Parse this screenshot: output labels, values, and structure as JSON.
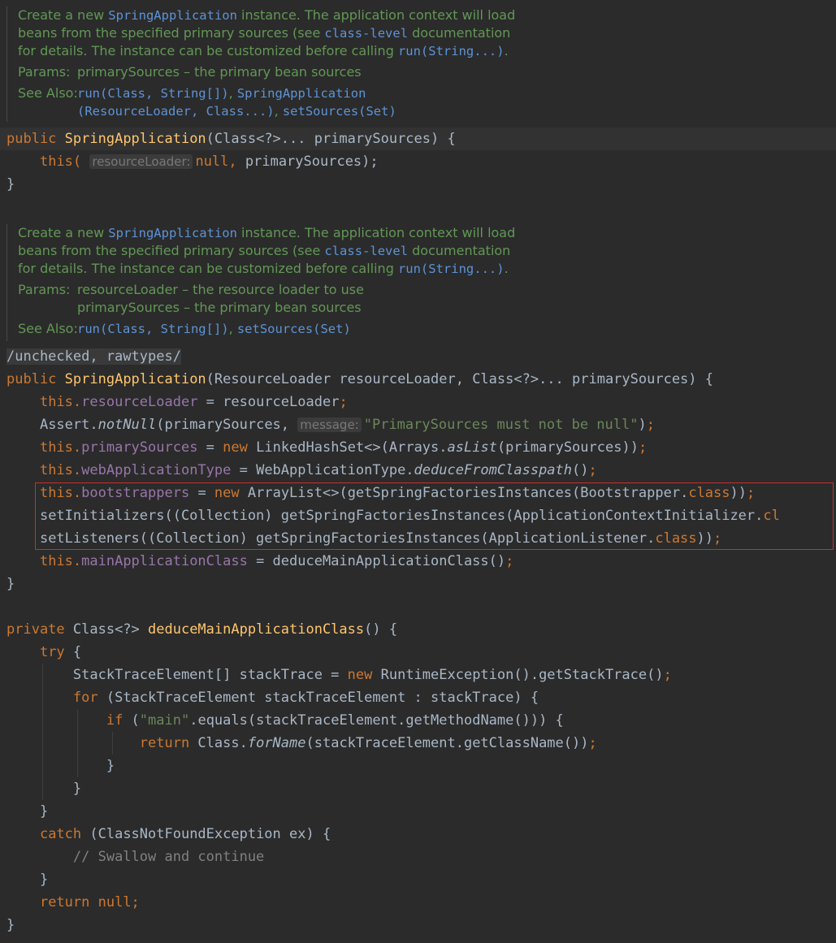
{
  "doc1": {
    "line1": {
      "a": "Create a new ",
      "code": "SpringApplication",
      "b": " instance. The application context will load"
    },
    "line2": {
      "a": "beans from the specified primary sources (see ",
      "code": "class-level",
      "b": " documentation"
    },
    "line3": {
      "a": "for details. The instance can be customized before calling ",
      "code": "run(String...)",
      "b": "."
    },
    "params_label": "Params:",
    "params": [
      "primarySources – the primary bean sources"
    ],
    "see_label": "See Also:",
    "see1": "run(Class, String[])",
    "see_sep": ",",
    "see2": "SpringApplication",
    "see3": "(ResourceLoader, Class...)",
    "see4": "setSources(Set)"
  },
  "code1": {
    "l1": {
      "kw": "public",
      "fn": "SpringApplication",
      "rest": "(Class<?>... primarySources) {"
    },
    "l2": {
      "kw": "this(",
      "hint": "resourceLoader:",
      "kw2": "null,",
      "rest": " primarySources);"
    },
    "l3": "}"
  },
  "doc2": {
    "line1": {
      "a": "Create a new ",
      "code": "SpringApplication",
      "b": " instance. The application context will load"
    },
    "line2": {
      "a": "beans from the specified primary sources (see ",
      "code": "class-level",
      "b": " documentation"
    },
    "line3": {
      "a": "for details. The instance can be customized before calling ",
      "code": "run(String...)",
      "b": "."
    },
    "params_label": "Params:",
    "params": [
      "resourceLoader – the resource loader to use",
      "primarySources – the primary bean sources"
    ],
    "see_label": "See Also:",
    "see1": "run(Class, String[])",
    "see_sep": ",",
    "see2": "setSources(Set)"
  },
  "code2": {
    "annotation": "/unchecked, rawtypes/",
    "sig": {
      "kw": "public",
      "fn": "SpringApplication",
      "rest": "(ResourceLoader resourceLoader, Class<?>... primarySources) {"
    },
    "a1": {
      "kw": "this.",
      "fld": "resourceLoader",
      "rest": " = resourceLoader",
      "semi": ";"
    },
    "a2": {
      "pre": "Assert.",
      "it": "notNull",
      "mid": "(primarySources, ",
      "hint": "message:",
      "str": "\"PrimarySources must not be null\"",
      "post": ")",
      "semi": ";"
    },
    "a3": {
      "kw": "this.",
      "fld": "primarySources",
      "eq": " = ",
      "kw2": "new",
      "rest": " LinkedHashSet<>(Arrays.",
      "it": "asList",
      "post": "(primarySources))",
      "semi": ";"
    },
    "a4": {
      "kw": "this.",
      "fld": "webApplicationType",
      "rest": " = WebApplicationType.",
      "it": "deduceFromClasspath",
      "post": "()",
      "semi": ";"
    },
    "a5": {
      "kw": "this.",
      "fld": "bootstrappers",
      "eq": " = ",
      "kw2": "new",
      "rest": " ArrayList<>(getSpringFactoriesInstances(Bootstrapper.",
      "kw3": "class",
      "post": "))",
      "semi": ";"
    },
    "a6": {
      "rest": "setInitializers((Collection) getSpringFactoriesInstances(ApplicationContextInitializer.",
      "kw3": "cl"
    },
    "a7": {
      "rest": "setListeners((Collection) getSpringFactoriesInstances(ApplicationListener.",
      "kw3": "class",
      "post": "))",
      "semi": ";"
    },
    "a8": {
      "kw": "this.",
      "fld": "mainApplicationClass",
      "rest": " = deduceMainApplicationClass()",
      "semi": ";"
    },
    "close": "}"
  },
  "code3": {
    "sig": {
      "kw": "private",
      "rest1": " Class<?> ",
      "fn": "deduceMainApplicationClass",
      "rest2": "() {"
    },
    "try": {
      "kw": "try",
      "rest": " {"
    },
    "b1": {
      "rest": "StackTraceElement[] stackTrace = ",
      "kw": "new",
      "post": " RuntimeException().getStackTrace()",
      "semi": ";"
    },
    "b2": {
      "kw": "for",
      "rest": " (StackTraceElement stackTraceElement : stackTrace) {"
    },
    "b3": {
      "kw": "if",
      "pre": " (",
      "str": "\"main\"",
      "rest": ".equals(stackTraceElement.getMethodName())) {"
    },
    "b4": {
      "kw": "return",
      "rest": " Class.",
      "it": "forName",
      "post": "(stackTraceElement.getClassName())",
      "semi": ";"
    },
    "c1": "}",
    "c2": "}",
    "c3": "}",
    "catch": {
      "kw": "catch",
      "rest": " (ClassNotFoundException ex) {"
    },
    "comment": "// Swallow and continue",
    "c4": "}",
    "ret": {
      "kw": "return",
      "kw2": " null;"
    },
    "close": "}"
  }
}
